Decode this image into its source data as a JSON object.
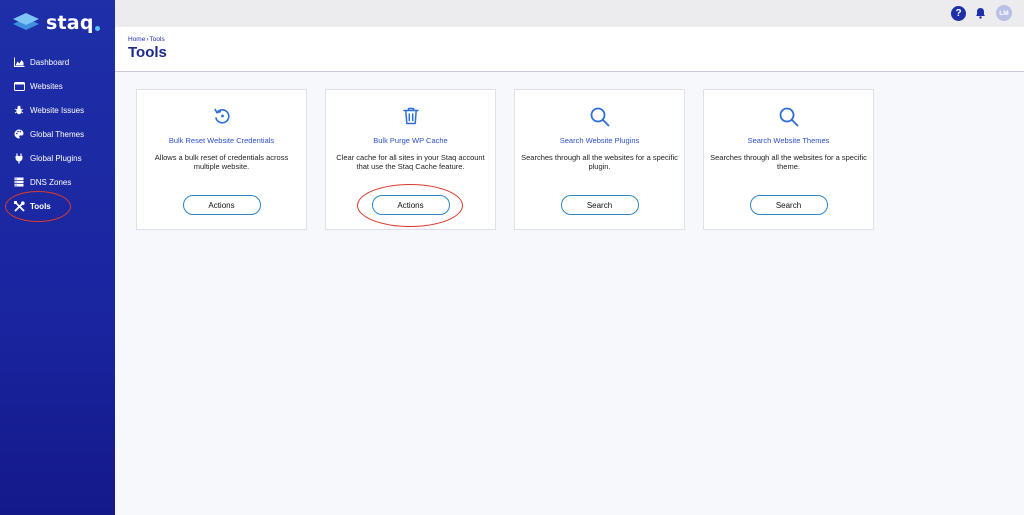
{
  "app": {
    "logo_text": "staq"
  },
  "sidebar": {
    "items": [
      {
        "label": "Dashboard",
        "icon": "chart-area-icon"
      },
      {
        "label": "Websites",
        "icon": "window-icon"
      },
      {
        "label": "Website Issues",
        "icon": "bug-icon"
      },
      {
        "label": "Global Themes",
        "icon": "palette-icon"
      },
      {
        "label": "Global Plugins",
        "icon": "plug-icon"
      },
      {
        "label": "DNS Zones",
        "icon": "server-icon"
      },
      {
        "label": "Tools",
        "icon": "tools-icon",
        "active": true
      }
    ]
  },
  "topbar": {
    "help_label": "?",
    "avatar_initials": "LM"
  },
  "header": {
    "breadcrumb": [
      "Home",
      "Tools"
    ],
    "breadcrumb_separator": "›",
    "title": "Tools"
  },
  "cards": [
    {
      "title": "Bulk Reset Website Credentials",
      "description": "Allows a bulk reset of credentials across multiple website.",
      "button": "Actions",
      "icon": "reset-icon"
    },
    {
      "title": "Bulk Purge WP Cache",
      "description": "Clear cache for all sites in your Staq account that use the Staq Cache feature.",
      "button": "Actions",
      "icon": "trash-icon"
    },
    {
      "title": "Search Website Plugins",
      "description": "Searches through all the websites for a specific plugin.",
      "button": "Search",
      "icon": "search-icon"
    },
    {
      "title": "Search Website Themes",
      "description": "Searches through all the websites for a specific theme.",
      "button": "Search",
      "icon": "search-icon"
    }
  ],
  "colors": {
    "sidebar": "#1e2fa8",
    "accent": "#2c50c8",
    "annotation": "#d93a2b"
  }
}
